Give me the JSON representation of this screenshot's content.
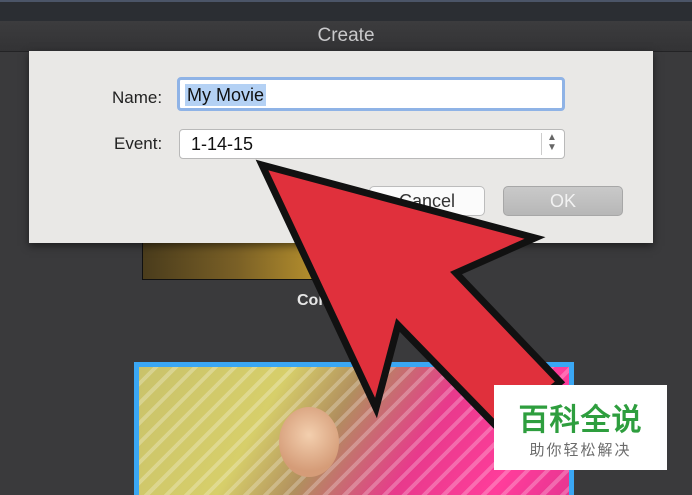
{
  "window": {
    "title": "Create"
  },
  "dialog": {
    "name_label": "Name:",
    "name_value": "My Movie",
    "event_label": "Event:",
    "event_value": "1-14-15",
    "cancel_label": "Cancel",
    "ok_label": "OK"
  },
  "background": {
    "thumbnail_label": "Con"
  },
  "overlay": {
    "arrow_color": "#e0303c"
  },
  "watermark": {
    "title": "百科全说",
    "subtitle": "助你轻松解决"
  },
  "colors": {
    "selection_highlight": "#b4d1f4",
    "focus_ring": "#8fb3e6",
    "thumbnail_selection": "#3aa7f4"
  }
}
